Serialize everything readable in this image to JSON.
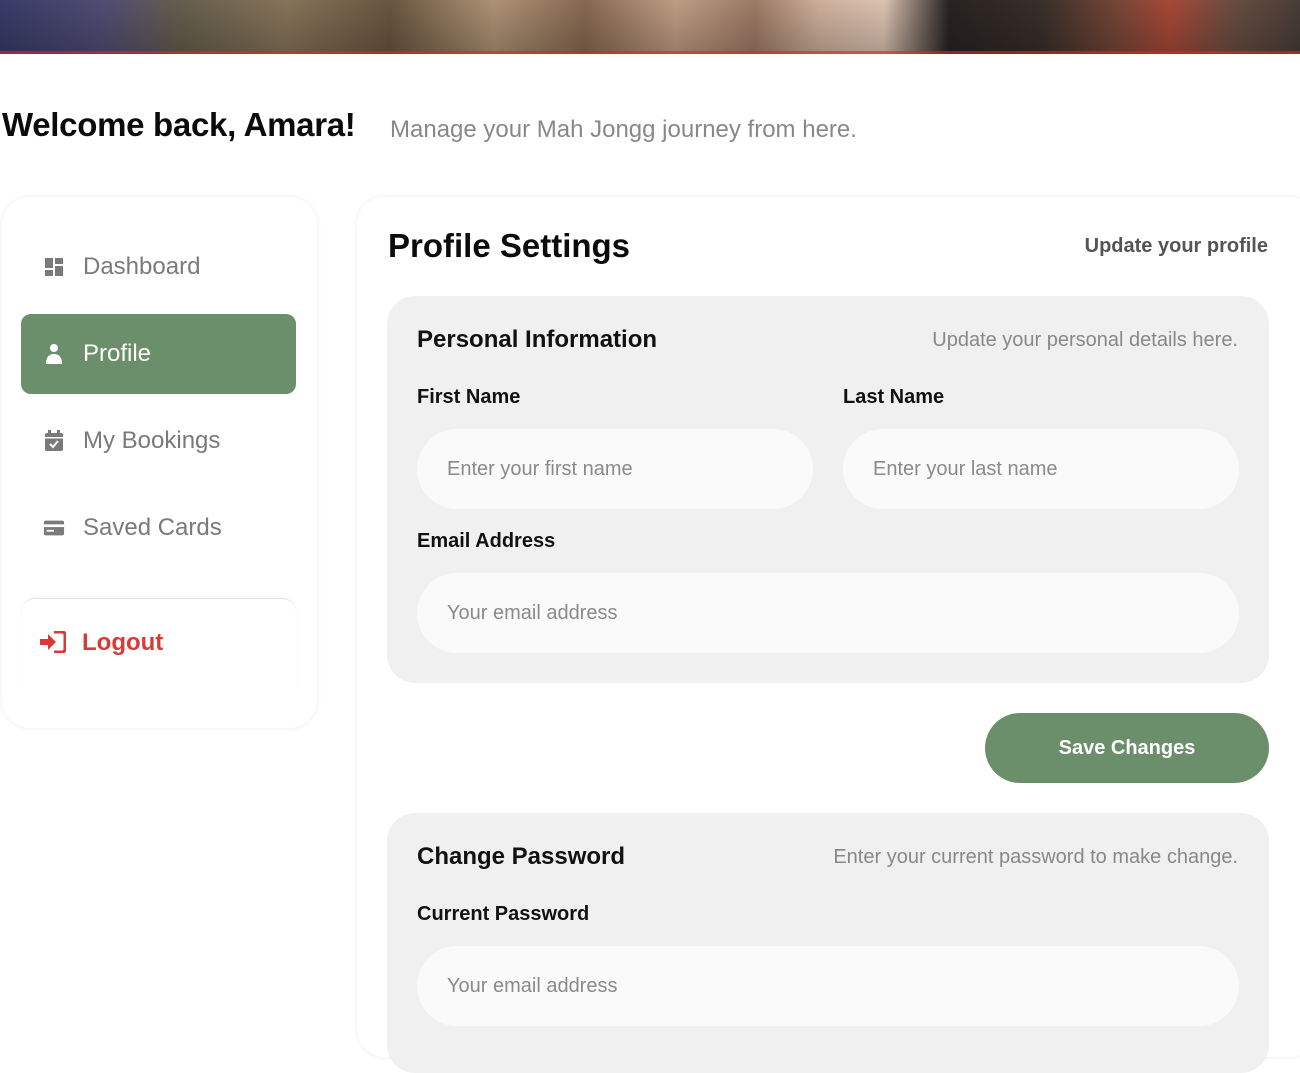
{
  "header": {
    "welcome": "Welcome back, Amara!",
    "subtitle": "Manage your Mah Jongg journey from here."
  },
  "sidebar": {
    "items": [
      {
        "label": "Dashboard",
        "icon": "dashboard-icon"
      },
      {
        "label": "Profile",
        "icon": "user-icon",
        "active": true
      },
      {
        "label": "My Bookings",
        "icon": "calendar-check-icon"
      },
      {
        "label": "Saved Cards",
        "icon": "credit-card-icon"
      }
    ],
    "logout": {
      "label": "Logout",
      "icon": "logout-icon"
    }
  },
  "main": {
    "title": "Profile Settings",
    "subtitle": "Update your profile",
    "personal": {
      "title": "Personal Information",
      "subtitle": "Update your personal details here.",
      "first_name_label": "First Name",
      "first_name_placeholder": "Enter your first name",
      "last_name_label": "Last Name",
      "last_name_placeholder": "Enter your last name",
      "email_label": "Email Address",
      "email_placeholder": "Your email address"
    },
    "save_label": "Save Changes",
    "password": {
      "title": "Change Password",
      "subtitle": "Enter your current password to make change.",
      "current_label": "Current Password",
      "current_placeholder": "Your email address"
    }
  },
  "colors": {
    "accent": "#6b8f6b",
    "logout": "#d93a36",
    "section_bg": "#f0f0f0"
  }
}
